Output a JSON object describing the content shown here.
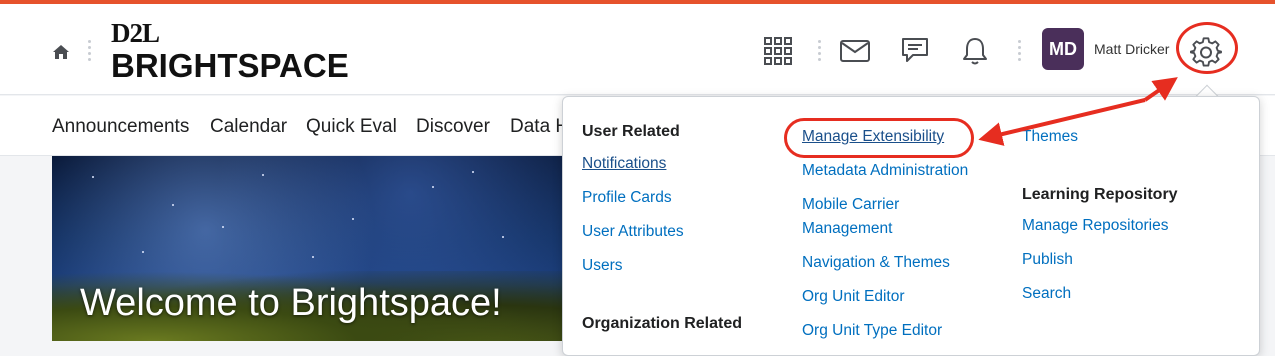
{
  "header": {
    "logo_top": "D2L",
    "logo_main": "BRIGHTSPACE",
    "user_initials": "MD",
    "user_name": "Matt Dricker"
  },
  "icons": {
    "home": "home-icon",
    "waffle": "waffle-icon",
    "mail": "mail-icon",
    "chat": "chat-icon",
    "bell": "bell-icon",
    "gear": "gear-icon"
  },
  "nav": {
    "items": [
      "Announcements",
      "Calendar",
      "Quick Eval",
      "Discover",
      "Data H"
    ]
  },
  "banner": {
    "welcome": "Welcome to Brightspace!"
  },
  "admin_menu": {
    "col1": {
      "heading": "User Related",
      "links": [
        "Notifications",
        "Profile Cards",
        "User Attributes",
        "Users"
      ],
      "heading2": "Organization Related"
    },
    "col2": {
      "links": [
        "Manage Extensibility",
        "Metadata Administration",
        "Mobile Carrier",
        "Management",
        "Navigation & Themes",
        "Org Unit Editor",
        "Org Unit Type Editor"
      ]
    },
    "col3": {
      "link0": "Themes",
      "heading": "Learning Repository",
      "links": [
        "Manage Repositories",
        "Publish",
        "Search"
      ]
    }
  },
  "colors": {
    "accent": "#e6522c",
    "link": "#006fbf",
    "annotation": "#e62d20",
    "avatar": "#4a2f5a"
  }
}
